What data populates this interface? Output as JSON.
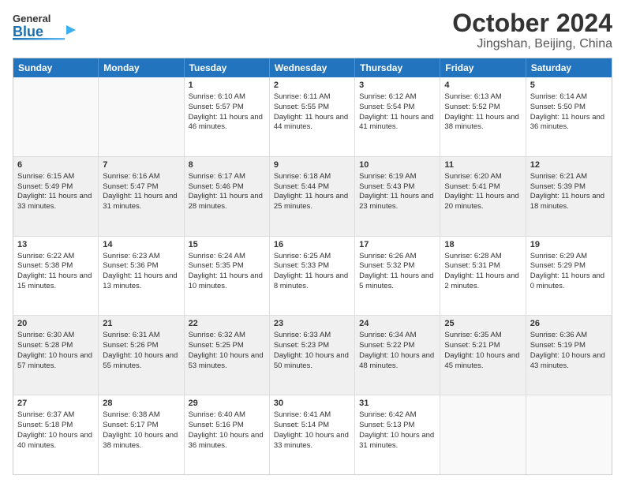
{
  "header": {
    "logo_general": "General",
    "logo_blue": "Blue",
    "title": "October 2024",
    "subtitle": "Jingshan, Beijing, China"
  },
  "calendar": {
    "days_of_week": [
      "Sunday",
      "Monday",
      "Tuesday",
      "Wednesday",
      "Thursday",
      "Friday",
      "Saturday"
    ],
    "rows": [
      [
        {
          "day": "",
          "sunrise": "",
          "sunset": "",
          "daylight": "",
          "empty": true
        },
        {
          "day": "",
          "sunrise": "",
          "sunset": "",
          "daylight": "",
          "empty": true
        },
        {
          "day": "1",
          "sunrise": "Sunrise: 6:10 AM",
          "sunset": "Sunset: 5:57 PM",
          "daylight": "Daylight: 11 hours and 46 minutes.",
          "empty": false
        },
        {
          "day": "2",
          "sunrise": "Sunrise: 6:11 AM",
          "sunset": "Sunset: 5:55 PM",
          "daylight": "Daylight: 11 hours and 44 minutes.",
          "empty": false
        },
        {
          "day": "3",
          "sunrise": "Sunrise: 6:12 AM",
          "sunset": "Sunset: 5:54 PM",
          "daylight": "Daylight: 11 hours and 41 minutes.",
          "empty": false
        },
        {
          "day": "4",
          "sunrise": "Sunrise: 6:13 AM",
          "sunset": "Sunset: 5:52 PM",
          "daylight": "Daylight: 11 hours and 38 minutes.",
          "empty": false
        },
        {
          "day": "5",
          "sunrise": "Sunrise: 6:14 AM",
          "sunset": "Sunset: 5:50 PM",
          "daylight": "Daylight: 11 hours and 36 minutes.",
          "empty": false
        }
      ],
      [
        {
          "day": "6",
          "sunrise": "Sunrise: 6:15 AM",
          "sunset": "Sunset: 5:49 PM",
          "daylight": "Daylight: 11 hours and 33 minutes.",
          "empty": false
        },
        {
          "day": "7",
          "sunrise": "Sunrise: 6:16 AM",
          "sunset": "Sunset: 5:47 PM",
          "daylight": "Daylight: 11 hours and 31 minutes.",
          "empty": false
        },
        {
          "day": "8",
          "sunrise": "Sunrise: 6:17 AM",
          "sunset": "Sunset: 5:46 PM",
          "daylight": "Daylight: 11 hours and 28 minutes.",
          "empty": false
        },
        {
          "day": "9",
          "sunrise": "Sunrise: 6:18 AM",
          "sunset": "Sunset: 5:44 PM",
          "daylight": "Daylight: 11 hours and 25 minutes.",
          "empty": false
        },
        {
          "day": "10",
          "sunrise": "Sunrise: 6:19 AM",
          "sunset": "Sunset: 5:43 PM",
          "daylight": "Daylight: 11 hours and 23 minutes.",
          "empty": false
        },
        {
          "day": "11",
          "sunrise": "Sunrise: 6:20 AM",
          "sunset": "Sunset: 5:41 PM",
          "daylight": "Daylight: 11 hours and 20 minutes.",
          "empty": false
        },
        {
          "day": "12",
          "sunrise": "Sunrise: 6:21 AM",
          "sunset": "Sunset: 5:39 PM",
          "daylight": "Daylight: 11 hours and 18 minutes.",
          "empty": false
        }
      ],
      [
        {
          "day": "13",
          "sunrise": "Sunrise: 6:22 AM",
          "sunset": "Sunset: 5:38 PM",
          "daylight": "Daylight: 11 hours and 15 minutes.",
          "empty": false
        },
        {
          "day": "14",
          "sunrise": "Sunrise: 6:23 AM",
          "sunset": "Sunset: 5:36 PM",
          "daylight": "Daylight: 11 hours and 13 minutes.",
          "empty": false
        },
        {
          "day": "15",
          "sunrise": "Sunrise: 6:24 AM",
          "sunset": "Sunset: 5:35 PM",
          "daylight": "Daylight: 11 hours and 10 minutes.",
          "empty": false
        },
        {
          "day": "16",
          "sunrise": "Sunrise: 6:25 AM",
          "sunset": "Sunset: 5:33 PM",
          "daylight": "Daylight: 11 hours and 8 minutes.",
          "empty": false
        },
        {
          "day": "17",
          "sunrise": "Sunrise: 6:26 AM",
          "sunset": "Sunset: 5:32 PM",
          "daylight": "Daylight: 11 hours and 5 minutes.",
          "empty": false
        },
        {
          "day": "18",
          "sunrise": "Sunrise: 6:28 AM",
          "sunset": "Sunset: 5:31 PM",
          "daylight": "Daylight: 11 hours and 2 minutes.",
          "empty": false
        },
        {
          "day": "19",
          "sunrise": "Sunrise: 6:29 AM",
          "sunset": "Sunset: 5:29 PM",
          "daylight": "Daylight: 11 hours and 0 minutes.",
          "empty": false
        }
      ],
      [
        {
          "day": "20",
          "sunrise": "Sunrise: 6:30 AM",
          "sunset": "Sunset: 5:28 PM",
          "daylight": "Daylight: 10 hours and 57 minutes.",
          "empty": false
        },
        {
          "day": "21",
          "sunrise": "Sunrise: 6:31 AM",
          "sunset": "Sunset: 5:26 PM",
          "daylight": "Daylight: 10 hours and 55 minutes.",
          "empty": false
        },
        {
          "day": "22",
          "sunrise": "Sunrise: 6:32 AM",
          "sunset": "Sunset: 5:25 PM",
          "daylight": "Daylight: 10 hours and 53 minutes.",
          "empty": false
        },
        {
          "day": "23",
          "sunrise": "Sunrise: 6:33 AM",
          "sunset": "Sunset: 5:23 PM",
          "daylight": "Daylight: 10 hours and 50 minutes.",
          "empty": false
        },
        {
          "day": "24",
          "sunrise": "Sunrise: 6:34 AM",
          "sunset": "Sunset: 5:22 PM",
          "daylight": "Daylight: 10 hours and 48 minutes.",
          "empty": false
        },
        {
          "day": "25",
          "sunrise": "Sunrise: 6:35 AM",
          "sunset": "Sunset: 5:21 PM",
          "daylight": "Daylight: 10 hours and 45 minutes.",
          "empty": false
        },
        {
          "day": "26",
          "sunrise": "Sunrise: 6:36 AM",
          "sunset": "Sunset: 5:19 PM",
          "daylight": "Daylight: 10 hours and 43 minutes.",
          "empty": false
        }
      ],
      [
        {
          "day": "27",
          "sunrise": "Sunrise: 6:37 AM",
          "sunset": "Sunset: 5:18 PM",
          "daylight": "Daylight: 10 hours and 40 minutes.",
          "empty": false
        },
        {
          "day": "28",
          "sunrise": "Sunrise: 6:38 AM",
          "sunset": "Sunset: 5:17 PM",
          "daylight": "Daylight: 10 hours and 38 minutes.",
          "empty": false
        },
        {
          "day": "29",
          "sunrise": "Sunrise: 6:40 AM",
          "sunset": "Sunset: 5:16 PM",
          "daylight": "Daylight: 10 hours and 36 minutes.",
          "empty": false
        },
        {
          "day": "30",
          "sunrise": "Sunrise: 6:41 AM",
          "sunset": "Sunset: 5:14 PM",
          "daylight": "Daylight: 10 hours and 33 minutes.",
          "empty": false
        },
        {
          "day": "31",
          "sunrise": "Sunrise: 6:42 AM",
          "sunset": "Sunset: 5:13 PM",
          "daylight": "Daylight: 10 hours and 31 minutes.",
          "empty": false
        },
        {
          "day": "",
          "sunrise": "",
          "sunset": "",
          "daylight": "",
          "empty": true
        },
        {
          "day": "",
          "sunrise": "",
          "sunset": "",
          "daylight": "",
          "empty": true
        }
      ]
    ]
  }
}
